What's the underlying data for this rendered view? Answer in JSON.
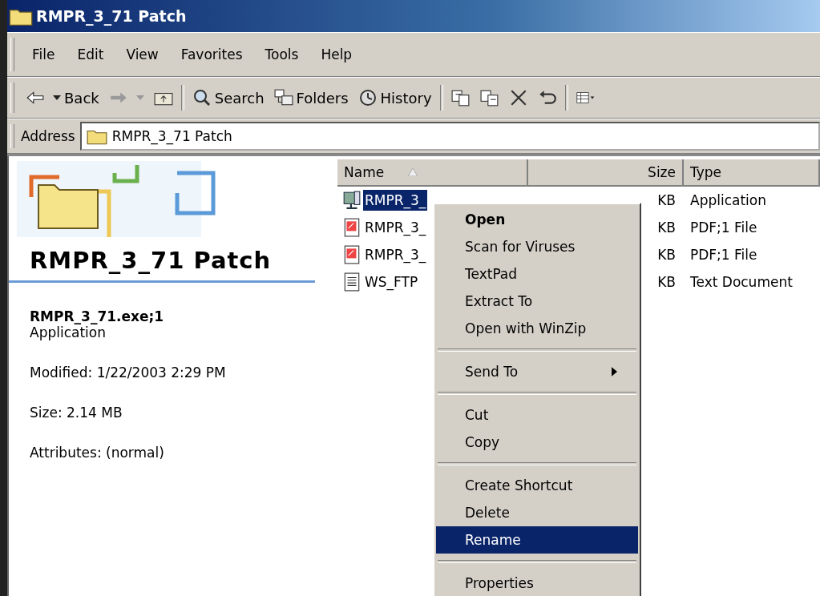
{
  "window": {
    "title": "RMPR_3_71 Patch"
  },
  "menu_bar": [
    "File",
    "Edit",
    "View",
    "Favorites",
    "Tools",
    "Help"
  ],
  "toolbar": [
    {
      "kind": "back",
      "label": "Back"
    },
    {
      "kind": "forward"
    },
    {
      "kind": "up"
    },
    {
      "kind": "search",
      "label": "Search"
    },
    {
      "kind": "folders",
      "label": "Folders"
    },
    {
      "kind": "history",
      "label": "History"
    },
    {
      "kind": "move"
    },
    {
      "kind": "copy"
    },
    {
      "kind": "delete"
    },
    {
      "kind": "undo"
    },
    {
      "kind": "views"
    }
  ],
  "address": {
    "label": "Address",
    "value": "RMPR_3_71 Patch"
  },
  "info_panel": {
    "title": "RMPR_3_71 Patch",
    "file_name": "RMPR_3_71.exe;1",
    "file_type": "Application",
    "modified": "Modified: 1/22/2003 2:29 PM",
    "size": "Size: 2.14 MB",
    "attributes": "Attributes: (normal)"
  },
  "file_list": {
    "columns": [
      "Name",
      "Size",
      "Type"
    ],
    "rows": [
      {
        "kind": "application",
        "name": "RMPR_3_",
        "size": "KB",
        "type": "Application",
        "selected": true
      },
      {
        "kind": "pdf",
        "name": "RMPR_3_",
        "size": "KB",
        "type": "PDF;1 File",
        "selected": false
      },
      {
        "kind": "pdf",
        "name": "RMPR_3_",
        "size": "KB",
        "type": "PDF;1 File",
        "selected": false
      },
      {
        "kind": "text",
        "name": "WS_FTP",
        "size": "KB",
        "type": "Text Document",
        "selected": false
      }
    ]
  },
  "context_menu": [
    {
      "kind": "item",
      "label": "Open",
      "default": true,
      "submenu": false,
      "selected": false
    },
    {
      "kind": "item",
      "label": "Scan for Viruses",
      "default": false,
      "submenu": false,
      "selected": false
    },
    {
      "kind": "item",
      "label": "TextPad",
      "default": false,
      "submenu": false,
      "selected": false
    },
    {
      "kind": "item",
      "label": "Extract To",
      "default": false,
      "submenu": false,
      "selected": false
    },
    {
      "kind": "item",
      "label": "Open with WinZip",
      "default": false,
      "submenu": false,
      "selected": false
    },
    {
      "kind": "separator"
    },
    {
      "kind": "item",
      "label": "Send To",
      "default": false,
      "submenu": true,
      "selected": false
    },
    {
      "kind": "separator"
    },
    {
      "kind": "item",
      "label": "Cut",
      "default": false,
      "submenu": false,
      "selected": false
    },
    {
      "kind": "item",
      "label": "Copy",
      "default": false,
      "submenu": false,
      "selected": false
    },
    {
      "kind": "separator"
    },
    {
      "kind": "item",
      "label": "Create Shortcut",
      "default": false,
      "submenu": false,
      "selected": false
    },
    {
      "kind": "item",
      "label": "Delete",
      "default": false,
      "submenu": false,
      "selected": false
    },
    {
      "kind": "item",
      "label": "Rename",
      "default": false,
      "submenu": false,
      "selected": true
    },
    {
      "kind": "separator"
    },
    {
      "kind": "item",
      "label": "Properties",
      "default": false,
      "submenu": false,
      "selected": false
    }
  ]
}
